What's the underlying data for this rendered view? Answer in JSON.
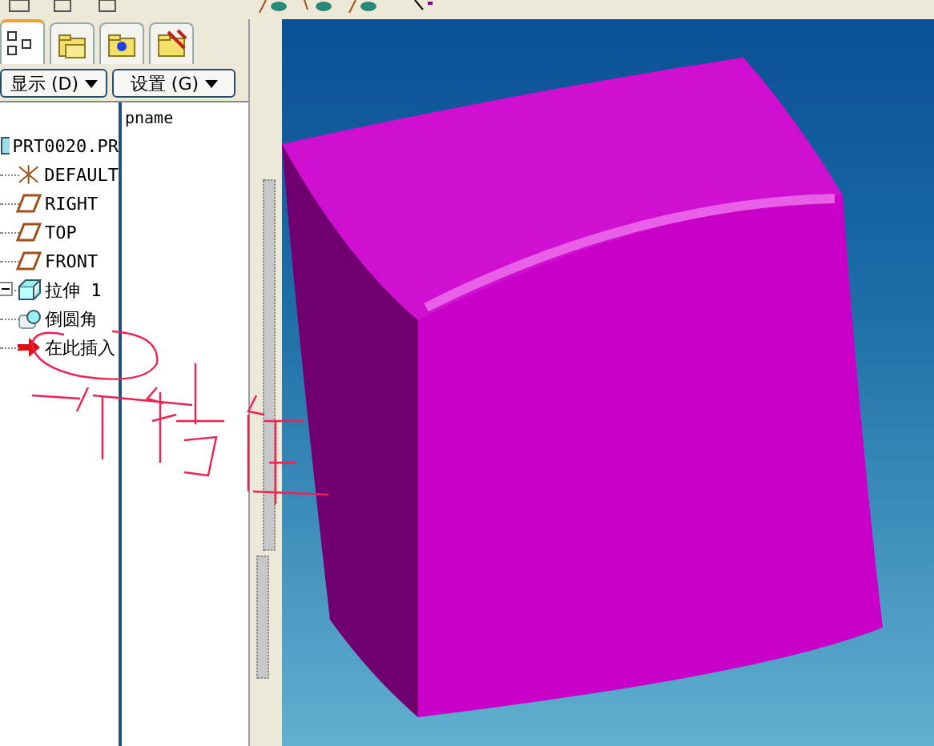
{
  "tabs": [
    {
      "selected": true
    },
    {
      "selected": false
    },
    {
      "selected": false
    },
    {
      "selected": false
    }
  ],
  "buttons": [
    {
      "label": "显示 (D)"
    },
    {
      "label": "设置 (G)"
    }
  ],
  "tree": {
    "column": "pname",
    "root": {
      "label": "PRT0020.PR",
      "children": [
        {
          "label": "DEFAULT",
          "kind": "csys"
        },
        {
          "label": "RIGHT",
          "kind": "plane"
        },
        {
          "label": "TOP",
          "kind": "plane"
        },
        {
          "label": "FRONT",
          "kind": "plane"
        },
        {
          "label": "拉伸 1",
          "kind": "extrude",
          "expanded": true
        },
        {
          "label": "倒圆角",
          "kind": "round"
        },
        {
          "label": "在此插入",
          "kind": "insert"
        }
      ]
    }
  }
}
